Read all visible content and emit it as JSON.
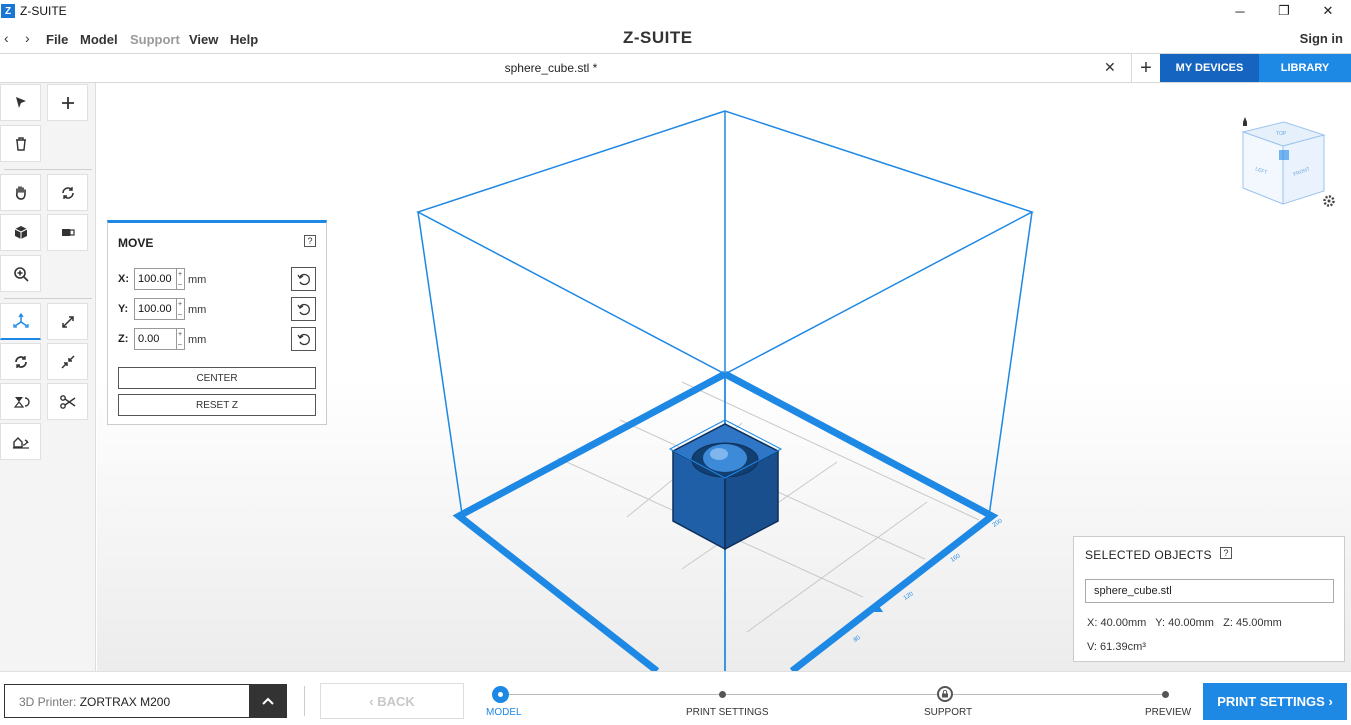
{
  "window": {
    "app_icon_letter": "Z",
    "title": "Z-SUITE",
    "minimize": "─",
    "restore": "❐",
    "close": "✕"
  },
  "menubar": {
    "back_arrow": "‹",
    "forward_arrow": "›",
    "menus": [
      "File",
      "Model",
      "Support",
      "View",
      "Help"
    ],
    "brand": "Z-SUITE",
    "sign_in": "Sign in"
  },
  "tabs": {
    "file_tab": "sphere_cube.stl *",
    "close": "✕",
    "add": "+",
    "my_devices": "MY DEVICES",
    "library": "LIBRARY"
  },
  "tools": [
    "select-tool",
    "add-tool",
    "delete-tool",
    "pan-tool",
    "rotate-view-tool",
    "view-cube-tool",
    "view-side-tool",
    "zoom-tool",
    "move-tool",
    "scale-tool",
    "rotate-tool",
    "shrink-tool",
    "flip-tool",
    "cut-tool",
    "place-on-bed-tool"
  ],
  "move_panel": {
    "title": "MOVE",
    "help": "?",
    "x_label": "X:",
    "x_value": "100.00",
    "y_label": "Y:",
    "y_value": "100.00",
    "z_label": "Z:",
    "z_value": "0.00",
    "unit": "mm",
    "spin_up": "+",
    "spin_down": "–",
    "center_label": "CENTER",
    "reset_z_label": "RESET Z"
  },
  "viewcube": {
    "top": "TOP",
    "left": "LEFT",
    "front": "FRONT"
  },
  "bed_ticks": [
    "200",
    "160",
    "120",
    "80"
  ],
  "selected_objects": {
    "title": "SELECTED OBJECTS",
    "help": "?",
    "name": "sphere_cube.stl",
    "dims": "X: 40.00mm   Y: 40.00mm   Z: 45.00mm",
    "volume": "V: 61.39cm³"
  },
  "bottom": {
    "printer_prefix": "3D Printer: ",
    "printer_name": "ZORTRAX M200",
    "toggle": "⌃",
    "back_label": "‹  BACK",
    "steps": [
      "MODEL",
      "PRINT SETTINGS",
      "SUPPORT",
      "PREVIEW"
    ],
    "print_settings_label": "PRINT SETTINGS  ›"
  },
  "colors": {
    "accent": "#1e88e5",
    "accent_dark": "#1565c0",
    "model": "#1f5fa8"
  }
}
